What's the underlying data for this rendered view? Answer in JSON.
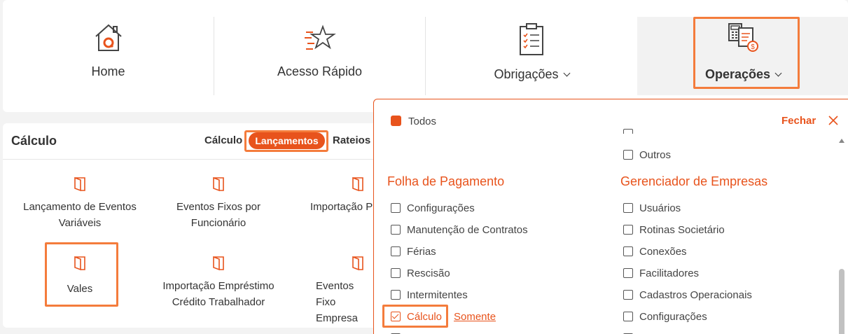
{
  "topnav": {
    "items": [
      {
        "label": "Home",
        "icon": "home-icon"
      },
      {
        "label": "Acesso Rápido",
        "icon": "star-icon"
      },
      {
        "label": "Obrigações",
        "icon": "clipboard-icon"
      },
      {
        "label": "Operações",
        "icon": "calculator-document-icon"
      }
    ]
  },
  "panel": {
    "title": "Cálculo",
    "tabs": [
      "Cálculo",
      "Lançamentos",
      "Rateios"
    ],
    "active_tab": "Lançamentos",
    "cards": [
      {
        "label": "Lançamento de Eventos Variáveis"
      },
      {
        "label": "Eventos Fixos por Funcionário"
      },
      {
        "label": "Importação P"
      },
      {
        "label": "Vales"
      },
      {
        "label": "Importação Empréstimo Crédito Trabalhador"
      },
      {
        "label": "Eventos Fixo Empresa"
      }
    ]
  },
  "dropdown": {
    "todos": "Todos",
    "close": "Fechar",
    "right_top_partial": "Outros",
    "sections": [
      {
        "title": "Folha de Pagamento",
        "options": [
          "Configurações",
          "Manutenção de Contratos",
          "Férias",
          "Rescisão",
          "Intermitentes",
          "Cálculo"
        ]
      },
      {
        "title": "Gerenciador de Empresas",
        "options": [
          "Usuários",
          "Rotinas Societário",
          "Conexões",
          "Facilitadores",
          "Cadastros Operacionais",
          "Configurações"
        ]
      }
    ],
    "selected": "Cálculo",
    "somente": "Somente"
  },
  "colors": {
    "accent": "#e8531c",
    "highlight": "#f47c3c"
  }
}
